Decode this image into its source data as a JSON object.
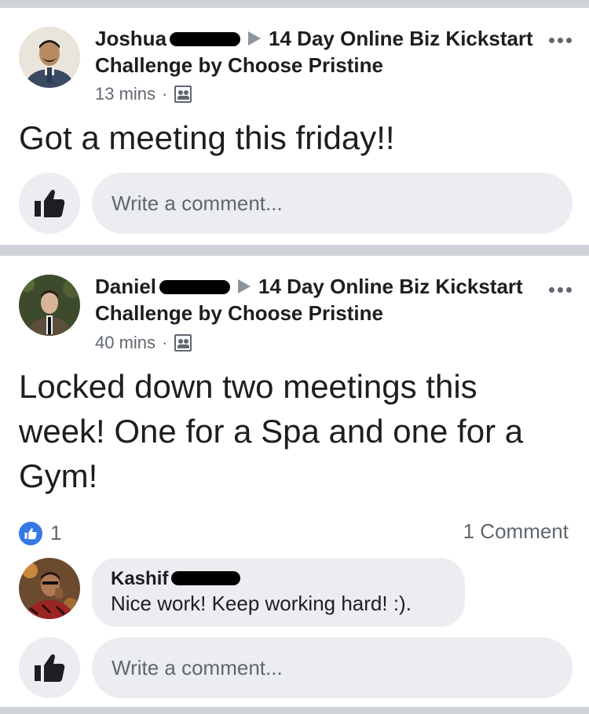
{
  "posts": [
    {
      "author": "Joshua",
      "group": "14 Day Online Biz Kickstart Challenge by Choose Pristine",
      "time": "13 mins",
      "text": "Got a meeting this friday!!",
      "comment_placeholder": "Write a comment..."
    },
    {
      "author": "Daniel",
      "group": "14 Day Online Biz Kickstart Challenge by Choose Pristine",
      "time": "40 mins",
      "text": "Locked down two meetings this week! One for a Spa and one for a Gym!",
      "reaction_count": "1",
      "comment_count": "1 Comment",
      "comment": {
        "author": "Kashif",
        "text": "Nice work! Keep working hard! :)."
      },
      "comment_placeholder": "Write a comment..."
    }
  ],
  "colors": {
    "separator": "#cfd2d7",
    "bubble": "#ebedf0",
    "secondary_text": "#606770",
    "like_blue": "#3578e5"
  },
  "icons": [
    "more-options-icon",
    "audience-group-icon",
    "thumbs-up-icon",
    "like-reaction-icon"
  ]
}
